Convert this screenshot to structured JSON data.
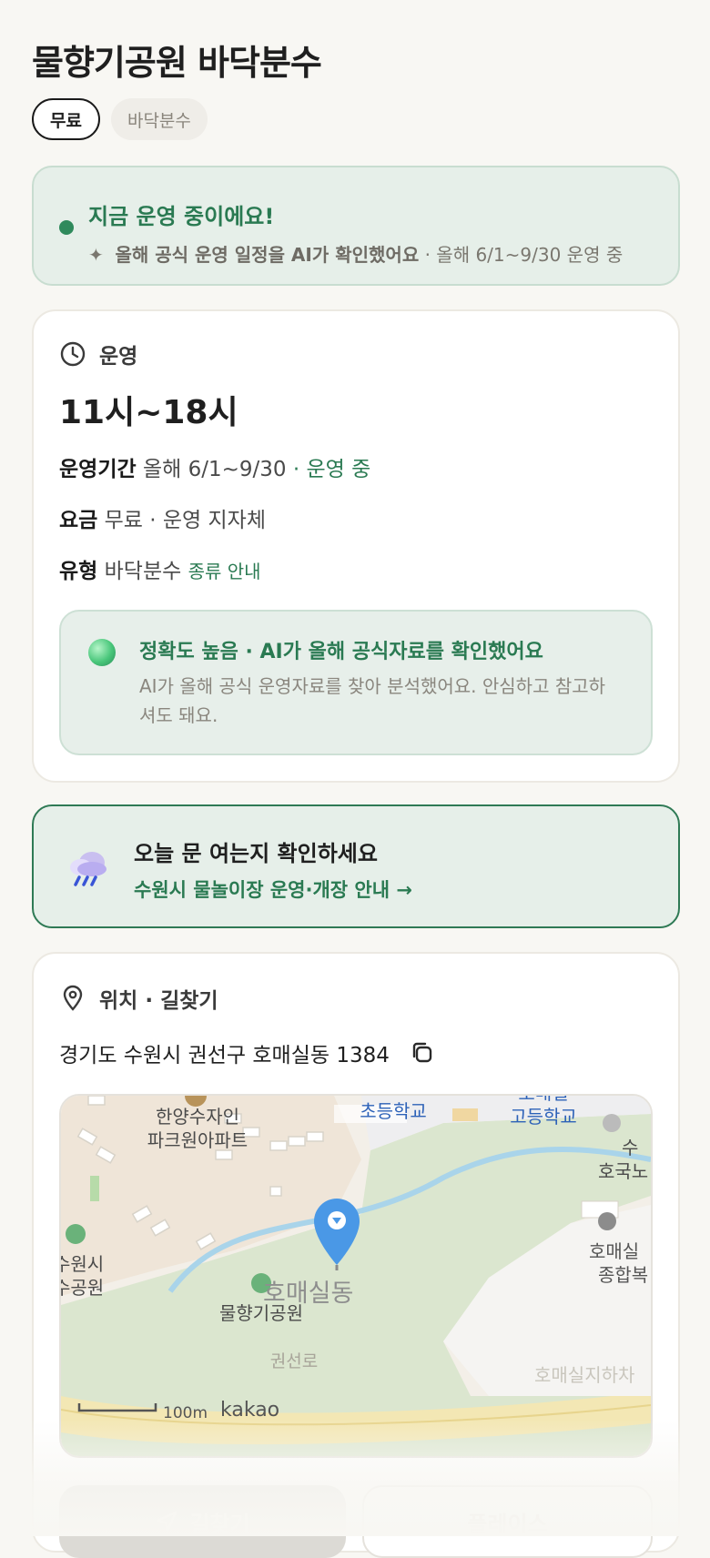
{
  "title": "물향기공원 바닥분수",
  "chips": {
    "free": "무료",
    "type": "바닥분수"
  },
  "status": {
    "headline": "지금 운영 중이에요!",
    "ai_note": "올해 공식 운영 일정을 AI가 확인했어요",
    "period_note": "· 올해 6/1~9/30 운영 중"
  },
  "operation": {
    "section_label": "운영",
    "hours": "11시~18시",
    "period_label": "운영기간",
    "period_value": "올해 6/1~9/30",
    "period_status": "· 운영 중",
    "fee_label": "요금",
    "fee_value": "무료 · 운영 지자체",
    "type_label": "유형",
    "type_value": "바닥분수",
    "type_link": "종류 안내",
    "accuracy_title": "정확도 높음 · AI가 올해 공식자료를 확인했어요",
    "accuracy_desc": "AI가 올해 공식 운영자료를 찾아 분석했어요. 안심하고 참고하셔도 돼요."
  },
  "notice": {
    "title": "오늘 문 여는지 확인하세요",
    "link": "수원시 물놀이장 운영·개장 안내 →"
  },
  "location": {
    "section_label": "위치 · 길찾기",
    "address": "경기도 수원시 권선구 호매실동 1384",
    "map": {
      "labels": {
        "apt": "한양수자인",
        "apt2": "파크원아파트",
        "school1": "초등학교",
        "school2a": "호매실",
        "school2b": "고등학교",
        "right1": "수",
        "right2": "호국노",
        "right3": "호매실",
        "right4": "종합복",
        "left1": "수원시",
        "left2": "수공원",
        "dong": "호매실동",
        "park": "물향기공원",
        "road": "권선로",
        "station": "호매실지하차",
        "scale": "100m",
        "brand": "kakao"
      }
    },
    "directions_button": "길찾기",
    "place_button": "플레이스"
  },
  "colors": {
    "accent": "#2a7a52",
    "pin": "#4a98e6"
  }
}
